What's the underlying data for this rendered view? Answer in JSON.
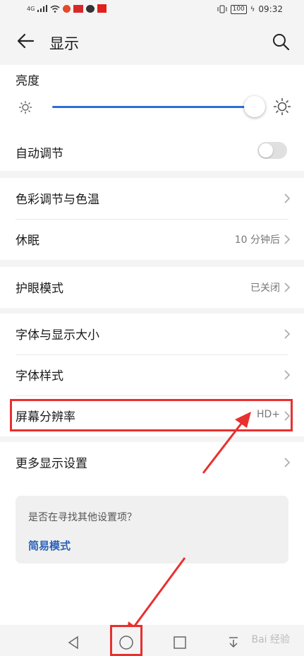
{
  "status_bar": {
    "signal_label": "4G",
    "battery": "100",
    "time": "09:32"
  },
  "header": {
    "title": "显示"
  },
  "brightness": {
    "label": "亮度",
    "level_percent": 95,
    "auto_label": "自动调节",
    "auto_on": false
  },
  "rows": {
    "color": {
      "label": "色彩调节与色温"
    },
    "sleep": {
      "label": "休眠",
      "value": "10 分钟后"
    },
    "eye": {
      "label": "护眼模式",
      "value": "已关闭"
    },
    "font_size": {
      "label": "字体与显示大小"
    },
    "font_style": {
      "label": "字体样式"
    },
    "resolution": {
      "label": "屏幕分辨率",
      "value": "HD+"
    },
    "more": {
      "label": "更多显示设置"
    }
  },
  "suggestion": {
    "question": "是否在寻找其他设置项？",
    "link": "简易模式"
  },
  "annotation_color": "#e8302e",
  "accent_color": "#2a6fd6",
  "watermark": "Bai 经验"
}
